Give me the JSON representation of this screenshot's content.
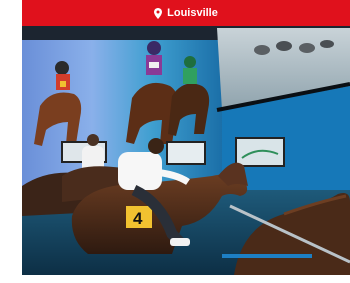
{
  "location": {
    "label": "Louisville",
    "icon": "map-pin-icon"
  },
  "photo": {
    "subject": "horse-racing-simulator-room"
  },
  "colors": {
    "brand_red": "#e0111c",
    "text_on_brand": "#ffffff"
  }
}
